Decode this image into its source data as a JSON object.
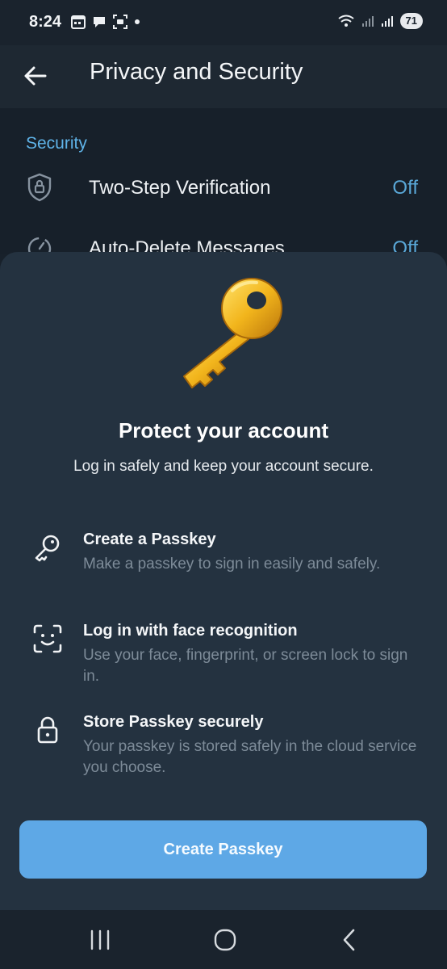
{
  "status_bar": {
    "time": "8:24",
    "battery": "71"
  },
  "app_bar": {
    "title": "Privacy and Security"
  },
  "security_section": {
    "title": "Security",
    "rows": [
      {
        "label": "Two-Step Verification",
        "value": "Off",
        "icon": "shield-lock-icon"
      },
      {
        "label": "Auto-Delete Messages",
        "value": "Off",
        "icon": "timer-icon"
      }
    ]
  },
  "sheet": {
    "hero_icon": "key-icon",
    "title": "Protect your account",
    "subtitle": "Log in safely and keep your account secure.",
    "features": [
      {
        "icon": "key-outline-icon",
        "title": "Create a Passkey",
        "description": "Make a passkey to sign in easily and safely."
      },
      {
        "icon": "face-scan-icon",
        "title": "Log in with face recognition",
        "description": "Use your face, fingerprint, or screen lock to sign in."
      },
      {
        "icon": "lock-icon",
        "title": "Store Passkey securely",
        "description": "Your passkey is stored safely in the cloud service you choose."
      }
    ],
    "button_label": "Create Passkey",
    "button_color": "#5ea8e6"
  },
  "nav_bar": {
    "recents": "recents-icon",
    "home": "home-icon",
    "back": "back-icon"
  },
  "colors": {
    "accent": "#5fb3e8",
    "sheet_bg": "#243240",
    "page_bg": "#18212b"
  }
}
